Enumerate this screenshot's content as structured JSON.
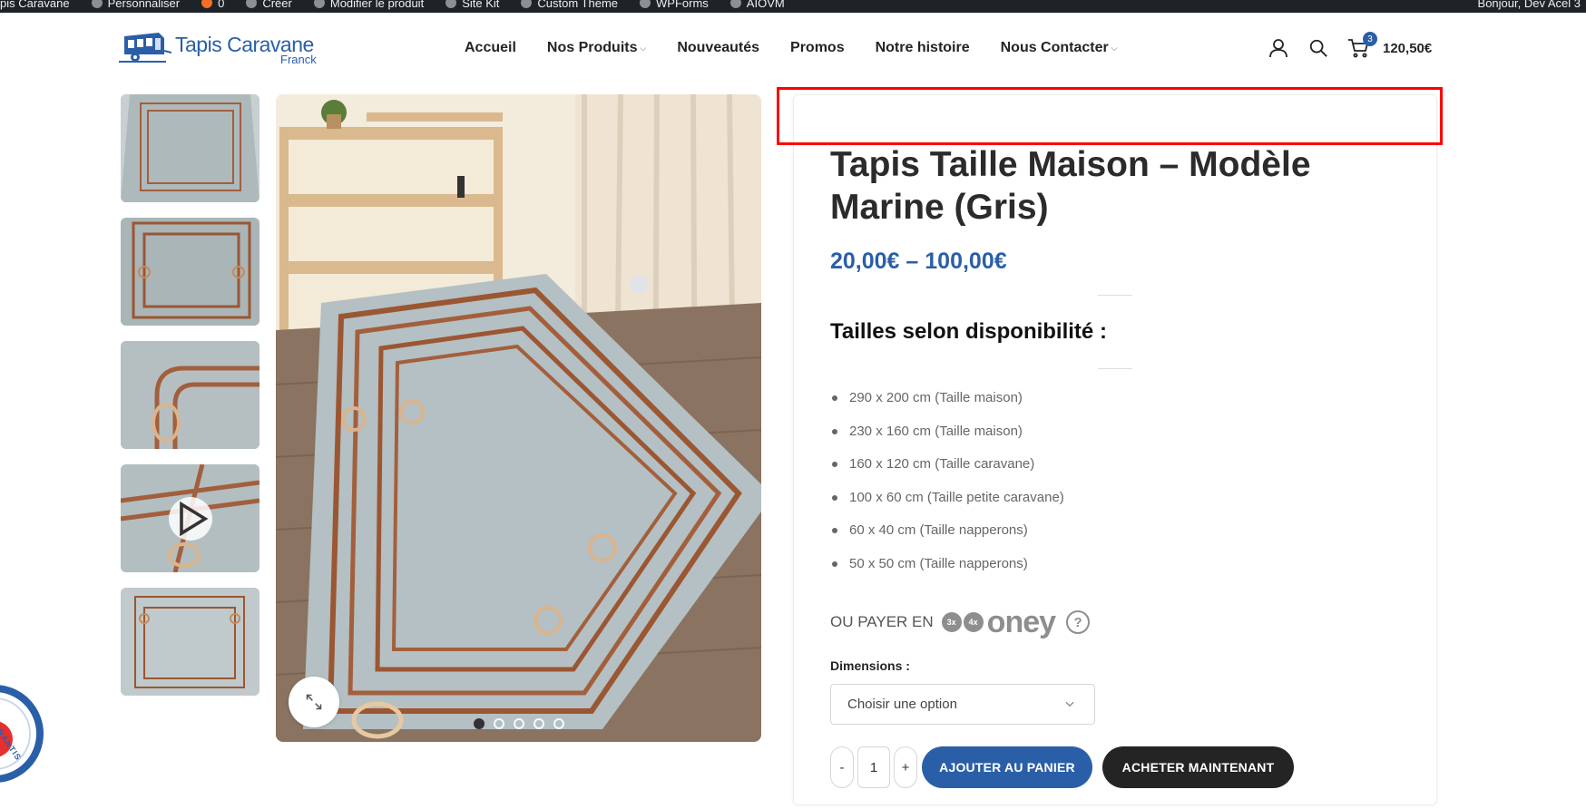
{
  "admin_bar": {
    "items": [
      "pis Caravane",
      "Personnaliser",
      "0",
      "Créer",
      "Modifier le produit",
      "Site Kit",
      "Custom Theme",
      "WPForms",
      "AIOVM"
    ],
    "greeting": "Bonjour, Dev Acel 3"
  },
  "header": {
    "logo_name": "Tapis Caravane",
    "logo_sub": "Franck",
    "nav": [
      {
        "label": "Accueil",
        "has_dropdown": false
      },
      {
        "label": "Nos Produits",
        "has_dropdown": true
      },
      {
        "label": "Nouveautés",
        "has_dropdown": false
      },
      {
        "label": "Promos",
        "has_dropdown": false
      },
      {
        "label": "Notre histoire",
        "has_dropdown": false
      },
      {
        "label": "Nous Contacter",
        "has_dropdown": true
      }
    ],
    "icons": [
      "user-icon",
      "search-icon",
      "cart-icon"
    ],
    "cart_count": "3",
    "cart_total": "120,50€"
  },
  "gallery": {
    "thumbnails": [
      "thumb-1",
      "thumb-2",
      "thumb-3",
      "thumb-video",
      "thumb-5"
    ],
    "dots_count": 5,
    "active_dot": 0
  },
  "product": {
    "title": "Tapis Taille Maison – Modèle Marine (Gris)",
    "price": "20,00€ – 100,00€",
    "sizes_heading": "Tailles selon disponibilité :",
    "sizes": [
      "290 x 200 cm (Taille maison)",
      "230 x 160 cm (Taille maison)",
      "160 x 120 cm (Taille caravane)",
      "100 x 60 cm (Taille petite caravane)",
      "60 x 40 cm (Taille napperons)",
      "50 x 50 cm (Taille napperons)"
    ],
    "oney": {
      "label": "OU PAYER EN",
      "pill_3x": "3x",
      "pill_4x": "4x",
      "brand": "oney",
      "help": "?"
    },
    "dimensions_label": "Dimensions :",
    "select_placeholder": "Choisir une option",
    "qty": {
      "minus": "-",
      "value": "1",
      "plus": "+"
    },
    "add_to_cart": "AJOUTER AU PANIER",
    "buy_now": "ACHETER MAINTENANT"
  },
  "badge": {
    "text": "S GARANTIS"
  },
  "colors": {
    "brand_blue": "#2a5fa8",
    "dark": "#242424",
    "highlight_red": "#ff0000"
  }
}
